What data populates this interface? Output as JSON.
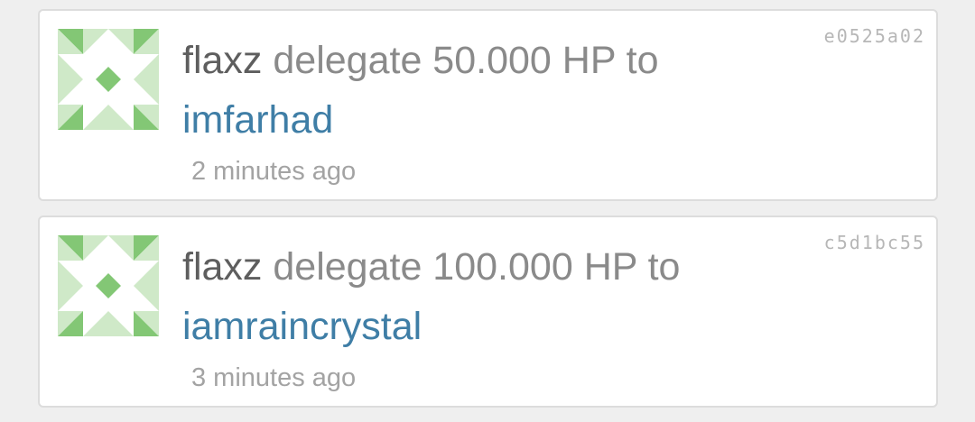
{
  "colors": {
    "background": "#efefef",
    "card": "#ffffff",
    "actor_text": "#5e5e5e",
    "action_text": "#8a8a8a",
    "link": "#3f7ea6",
    "timestamp": "#a3a3a3",
    "hash": "#b7b7b7",
    "identicon_dark": "#83c775",
    "identicon_light": "#cfe9c8"
  },
  "feed": {
    "items": [
      {
        "avatar_icon": "identicon-avatar",
        "actor": "flaxz",
        "action": "delegate 50.000 HP to",
        "target": "imfarhad",
        "time": "2 minutes ago",
        "tx_hash": "e0525a02"
      },
      {
        "avatar_icon": "identicon-avatar",
        "actor": "flaxz",
        "action": "delegate 100.000 HP to",
        "target": "iamraincrystal",
        "time": "3 minutes ago",
        "tx_hash": "c5d1bc55"
      }
    ]
  }
}
